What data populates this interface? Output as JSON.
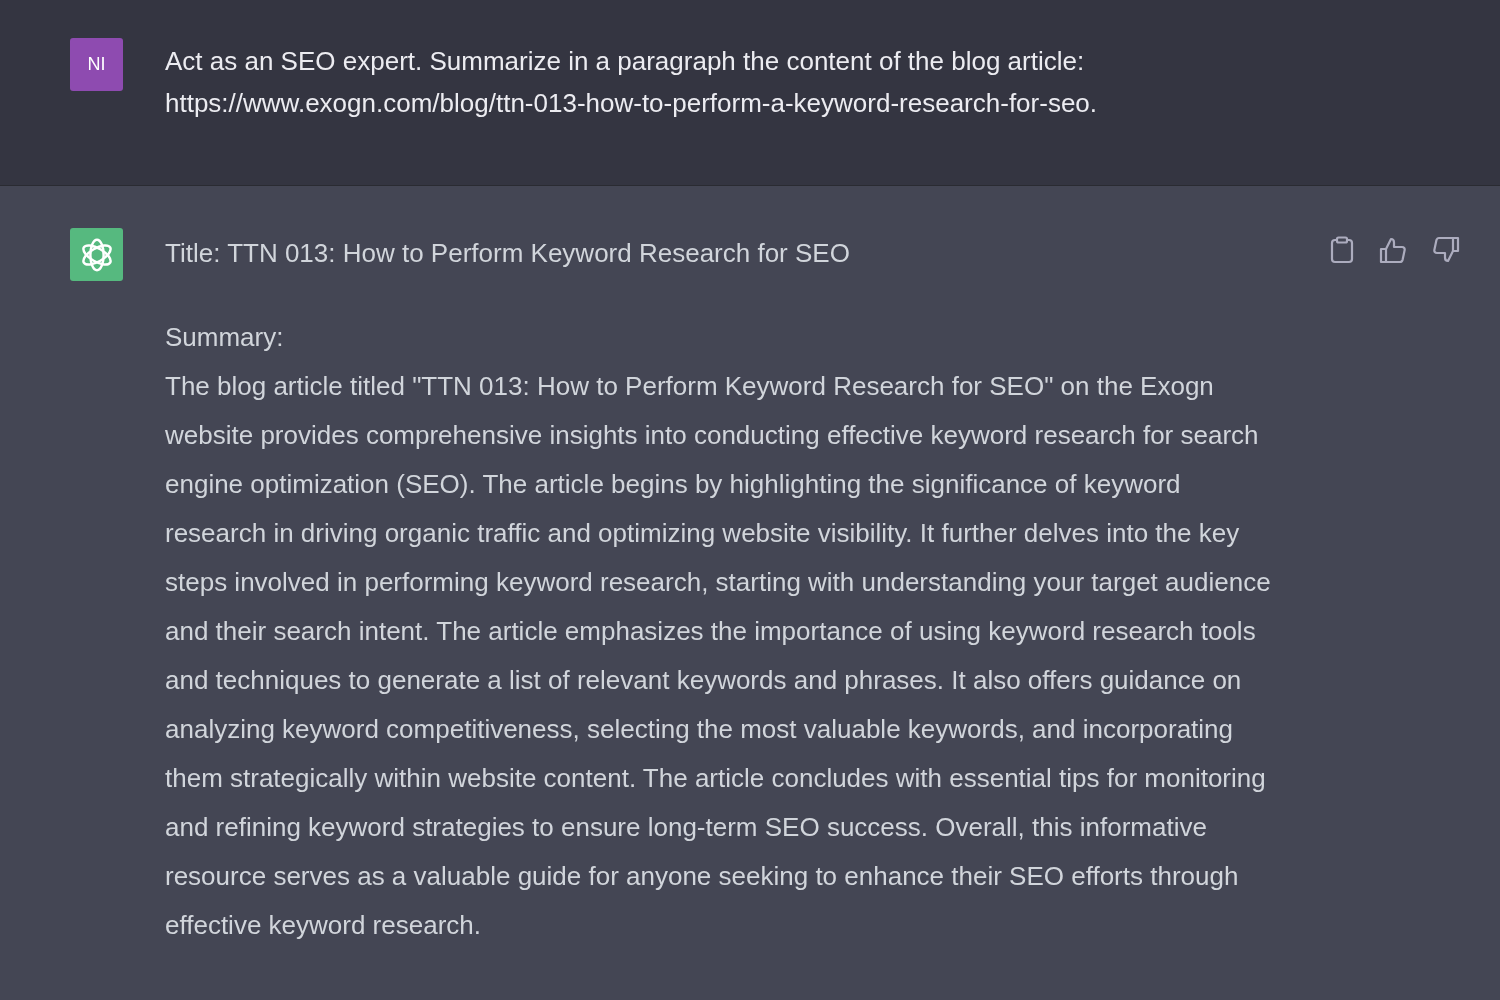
{
  "messages": [
    {
      "kind": "user",
      "avatar": "NI",
      "lines": [
        "Act as an SEO expert. Summarize in a paragraph the content of the blog article:",
        "https://www.exogn.com/blog/ttn-013-how-to-perform-a-keyword-research-for-seo."
      ]
    },
    {
      "kind": "assistant",
      "title": "Title: TTN 013: How to Perform Keyword Research for SEO",
      "label": "Summary:",
      "paragraph": "The blog article titled \"TTN 013: How to Perform Keyword Research for SEO\" on the Exogn website provides comprehensive insights into conducting effective keyword research for search engine optimization (SEO). The article begins by highlighting the significance of keyword research in driving organic traffic and optimizing website visibility. It further delves into the key steps involved in performing keyword research, starting with understanding your target audience and their search intent. The article emphasizes the importance of using keyword research tools and techniques to generate a list of relevant keywords and phrases. It also offers guidance on analyzing keyword competitiveness, selecting the most valuable keywords, and incorporating them strategically within website content. The article concludes with essential tips for monitoring and refining keyword strategies to ensure long-term SEO success. Overall, this informative resource serves as a valuable guide for anyone seeking to enhance their SEO efforts through effective keyword research."
    }
  ]
}
